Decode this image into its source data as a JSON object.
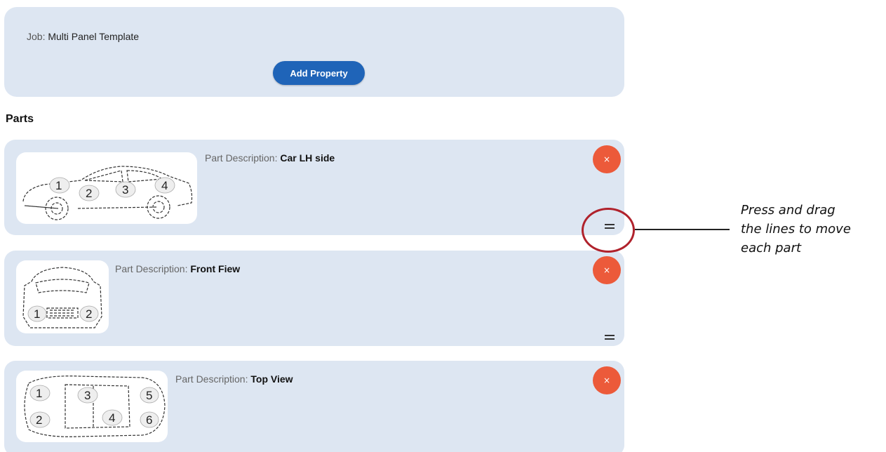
{
  "job": {
    "label": "Job:",
    "name": "Multi Panel Template",
    "add_property_label": "Add Property"
  },
  "parts_heading": "Parts",
  "parts": [
    {
      "description_label": "Part Description:",
      "description_value": "Car LH side",
      "delete_label": "×",
      "markers": [
        "1",
        "2",
        "3",
        "4"
      ]
    },
    {
      "description_label": "Part Description:",
      "description_value": "Front Fiew",
      "delete_label": "×",
      "markers": [
        "1",
        "2"
      ]
    },
    {
      "description_label": "Part Description:",
      "description_value": "Top View",
      "delete_label": "×",
      "markers": [
        "1",
        "2",
        "3",
        "4",
        "5",
        "6"
      ]
    }
  ],
  "hint": {
    "line1": "Press and drag",
    "line2": "the lines to move",
    "line3": "each part"
  },
  "colors": {
    "card_bg": "#dde6f2",
    "primary_button": "#1f64b8",
    "delete_button": "#ec5a3a",
    "highlight_ring": "#b0222c"
  },
  "icons": {
    "delete": "close-icon",
    "drag": "drag-handle-icon"
  }
}
